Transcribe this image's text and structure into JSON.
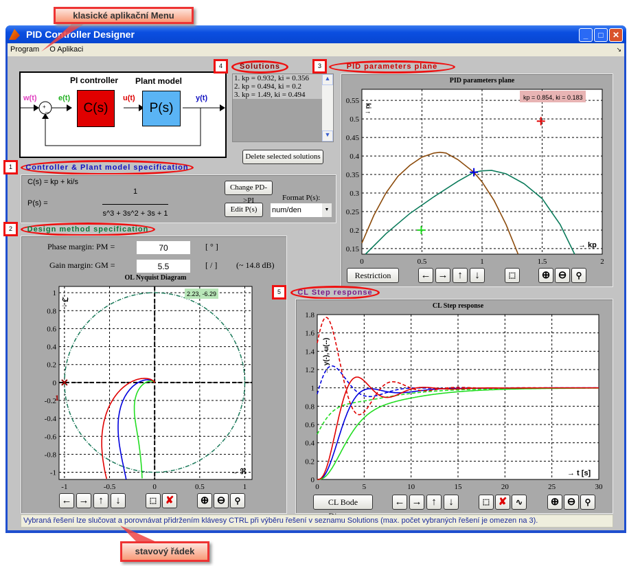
{
  "window": {
    "title": "PID Controller Designer"
  },
  "menu": [
    "Program",
    "O Aplikaci"
  ],
  "callouts": {
    "menu": "klasické aplikační Menu",
    "status": "stavový řádek",
    "n1": "1",
    "n2": "2",
    "n3": "3",
    "n4": "4",
    "n5": "5",
    "spec": "Controller & Plant model specification",
    "design": "Design method specification",
    "solutions": "Solutions",
    "plane": "PID parameters plane",
    "step": "CL Step response"
  },
  "diagram": {
    "controller_title": "PI controller",
    "plant_title": "Plant model",
    "w": "w(t)",
    "e": "e(t)",
    "u": "u(t)",
    "y": "y(t)",
    "c": "C(s)",
    "p": "P(s)",
    "sum_plus": "+",
    "sum_minus": "_"
  },
  "solutions": {
    "items": [
      "1. kp = 0.932, ki = 0.356",
      "2. kp = 0.494, ki = 0.2",
      "3. kp = 1.49, ki = 0.494"
    ],
    "delete_label": "Delete selected solutions"
  },
  "spec": {
    "cs": "C(s) = kp + ki/s",
    "ps_label": "P(s) =",
    "num": "1",
    "den": "s^3 + 3s^2 + 3s + 1",
    "change_label": "Change PD->PI",
    "edit_label": "Edit P(s)",
    "format_label": "Format P(s):",
    "format_value": "num/den"
  },
  "design": {
    "pm_label": "Phase margin:  PM =",
    "pm_value": "70",
    "pm_unit": "[ ° ]",
    "gm_label": "Gain margin:  GM =",
    "gm_value": "5.5",
    "gm_unit": "[ / ]",
    "gm_db": "(~ 14.8 dB)"
  },
  "buttons": {
    "restriction": "Restriction",
    "bode": "CL Bode Diagram"
  },
  "status": "Vybraná řešení lze slučovat a porovnávat přidržením klávesy CTRL při výběru řešení v seznamu Solutions (max. počet vybraných řešení je omezen na 3).",
  "colors": {
    "sol1": "#0000dd",
    "sol2": "#22dd22",
    "sol3": "#e00000",
    "pm_curve": "#8b4a0a",
    "gm_curve": "#0a7a5a"
  },
  "chart_data": [
    {
      "type": "line",
      "title": "PID parameters plane",
      "xlabel": "→ kp",
      "ylabel": "ki ↑",
      "xlim": [
        0,
        2
      ],
      "ylim": [
        0.135,
        0.58
      ],
      "xticks": [
        "0",
        "0.5",
        "1",
        "1.5",
        "2"
      ],
      "yticks": [
        "0.15",
        "0.2",
        "0.25",
        "0.3",
        "0.35",
        "0.4",
        "0.45",
        "0.5",
        "0.55"
      ],
      "grid": true,
      "annotation": "kp = 0.854, ki = 0.183",
      "series": [
        {
          "x": [
            0,
            0.1,
            0.2,
            0.3,
            0.4,
            0.5,
            0.6,
            0.65,
            0.7,
            0.8,
            0.932,
            1.0,
            1.1,
            1.2,
            1.3
          ],
          "y": [
            0.165,
            0.24,
            0.3,
            0.345,
            0.375,
            0.397,
            0.408,
            0.41,
            0.408,
            0.39,
            0.356,
            0.33,
            0.28,
            0.215,
            0.135
          ]
        },
        {
          "x": [
            0.03,
            0.2,
            0.4,
            0.6,
            0.8,
            0.932,
            1.0,
            1.08,
            1.2,
            1.35,
            1.5,
            1.65,
            1.77
          ],
          "y": [
            0.135,
            0.19,
            0.245,
            0.29,
            0.332,
            0.356,
            0.36,
            0.361,
            0.352,
            0.325,
            0.285,
            0.215,
            0.135
          ]
        }
      ],
      "points": [
        {
          "x": 0.932,
          "y": 0.356
        },
        {
          "x": 0.494,
          "y": 0.2
        },
        {
          "x": 1.49,
          "y": 0.494
        }
      ]
    },
    {
      "type": "line",
      "title": "OL Nyquist Diagram",
      "xlabel": "→ ℜ",
      "ylabel": "ℑ ↑",
      "xlim": [
        -1.06,
        1.08
      ],
      "ylim": [
        -1.08,
        1.07
      ],
      "xticks": [
        "-1",
        "-0.5",
        "0",
        "0.5",
        "1"
      ],
      "yticks": [
        "1",
        "0.8",
        "0.6",
        "0.4",
        "0.2",
        "0",
        "-0.2",
        "-0.4",
        "-0.6",
        "-0.8",
        "-1"
      ],
      "grid": true,
      "annotation": "2.23, -6.29",
      "critical_label": "1"
    },
    {
      "type": "line",
      "title": "CL  Step response",
      "xlabel": "→ t [s]",
      "ylabel": "→ y(-), u(--)",
      "xlim": [
        0,
        30
      ],
      "ylim": [
        0,
        1.8
      ],
      "xticks": [
        "0",
        "5",
        "10",
        "15",
        "20",
        "25",
        "30"
      ],
      "yticks": [
        "0",
        "0.2",
        "0.4",
        "0.6",
        "0.8",
        "1",
        "1.2",
        "1.4",
        "1.6",
        "1.8"
      ],
      "grid": true,
      "series": [
        {
          "kp": 0.932,
          "ki": 0.356
        },
        {
          "kp": 0.494,
          "ki": 0.2
        },
        {
          "kp": 1.49,
          "ki": 0.494
        }
      ]
    }
  ]
}
